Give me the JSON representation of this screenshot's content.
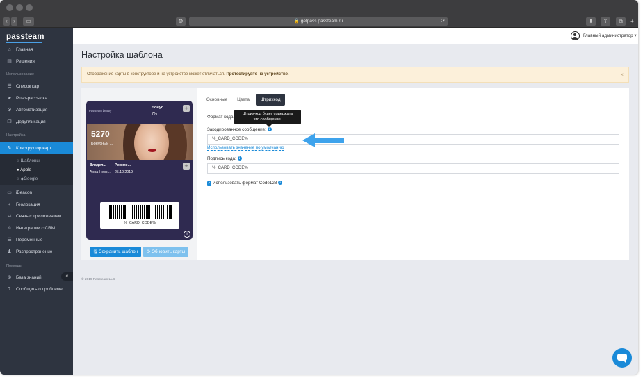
{
  "browser": {
    "url": "getpass.passteam.ru",
    "lock": "🔒",
    "back": "‹",
    "forward": "›",
    "reload": "⟳"
  },
  "sidebar": {
    "logo": "passteam",
    "sections": {
      "usage": "Использование",
      "settings": "Настройка",
      "help": "Помощь"
    },
    "items": {
      "home": "Главная",
      "solutions": "Решения",
      "cards": "Список карт",
      "push": "Push-рассылка",
      "automation": "Автоматизация",
      "duplication": "Дедупликация",
      "builder": "Конструктор карт",
      "ibeacon": "iBeacon",
      "geo": "Геолокация",
      "apps": "Связь с приложением",
      "crm": "Интеграции с CRM",
      "vars": "Переменные",
      "distribution": "Распространение",
      "kb": "База знаний",
      "report": "Сообщить о проблеме"
    },
    "sub": {
      "templates": "Шаблоны",
      "apple": "Apple",
      "google": "Google"
    },
    "collapse": "«"
  },
  "topbar": {
    "user": "Главный администратор ▾"
  },
  "page": {
    "title": "Настройка шаблона",
    "alert_text": "Отображение карты в конструкторе и на устройстве может отличаться. ",
    "alert_bold": "Протестируйте на устройстве",
    "alert_end": ".",
    "alert_close": "×"
  },
  "pass": {
    "logo": "Passteam beauty",
    "bonus_label": "Бонус",
    "bonus_value": "7%",
    "number": "5270",
    "strip_label": "Бонусный ...",
    "field1_label": "Владел...",
    "field1_value": "Анна Невс...",
    "field2_label": "Рекоме...",
    "field2_value": "25.10.2019",
    "barcode_text": "%_CARD_CODE%",
    "plus": "+",
    "info": "i"
  },
  "buttons": {
    "save": "🖫 Сохранить шаблон",
    "update": "⟳ Обновить карты"
  },
  "tabs": {
    "basic": "Основные",
    "colors": "Цвета",
    "barcode": "Штрихкод"
  },
  "form": {
    "format_label": "Формат кода:",
    "tooltip_line1": "Штрих-код будет содержать",
    "tooltip_line2": "это сообщение.",
    "encoded_label": "Закодированное сообщение:",
    "encoded_value": "%_CARD_CODE%",
    "default_link": "Использовать значение по умолчанию",
    "caption_label": "Подпись кода:",
    "caption_value": "%_CARD_CODE%",
    "code128_label": "Использовать формат Code128",
    "info": "i",
    "check": "✓"
  },
  "footer": {
    "copyright": "© 2019 Passteam LLC"
  },
  "colors": {
    "accent": "#1a8ad8",
    "sidebar": "#2e3440",
    "pass_bg": "#2f2a50",
    "alert_bg": "#fcf0da"
  }
}
